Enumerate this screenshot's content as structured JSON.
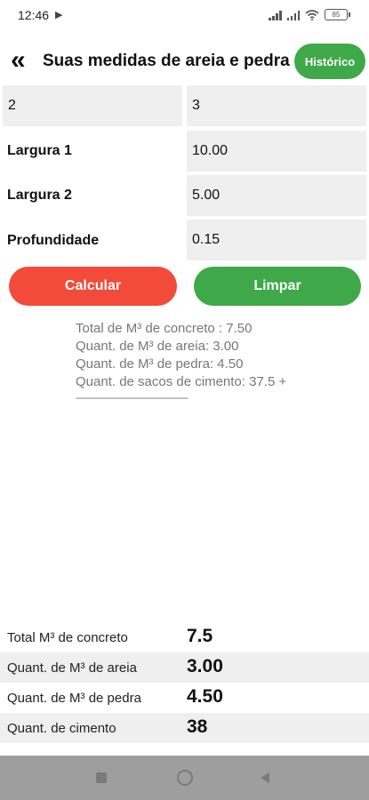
{
  "status": {
    "time": "12:46",
    "battery": "85"
  },
  "header": {
    "title": "Suas medidas de areia e pedra",
    "history_label": "Histórico"
  },
  "grid": {
    "top_left": "2",
    "top_right": "3",
    "rows": [
      {
        "label": "Largura 1",
        "value": "10.00"
      },
      {
        "label": "Largura 2",
        "value": "5.00"
      },
      {
        "label": "Profundidade",
        "value": "0.15"
      }
    ]
  },
  "buttons": {
    "calculate": "Calcular",
    "clear": "Limpar"
  },
  "summary": {
    "line1": "Total de M³ de concreto : 7.50",
    "line2": "Quant. de M³ de areia: 3.00",
    "line3": "Quant. de M³ de pedra: 4.50",
    "line4": "Quant. de sacos de cimento: 37.5  +",
    "line5": "------------------------------------------"
  },
  "results": [
    {
      "label": "Total M³ de concreto",
      "value": "7.5"
    },
    {
      "label": "Quant. de M³ de areia",
      "value": "3.00"
    },
    {
      "label": "Quant. de M³ de pedra",
      "value": "4.50"
    },
    {
      "label": "Quant. de cimento",
      "value": "38"
    }
  ]
}
